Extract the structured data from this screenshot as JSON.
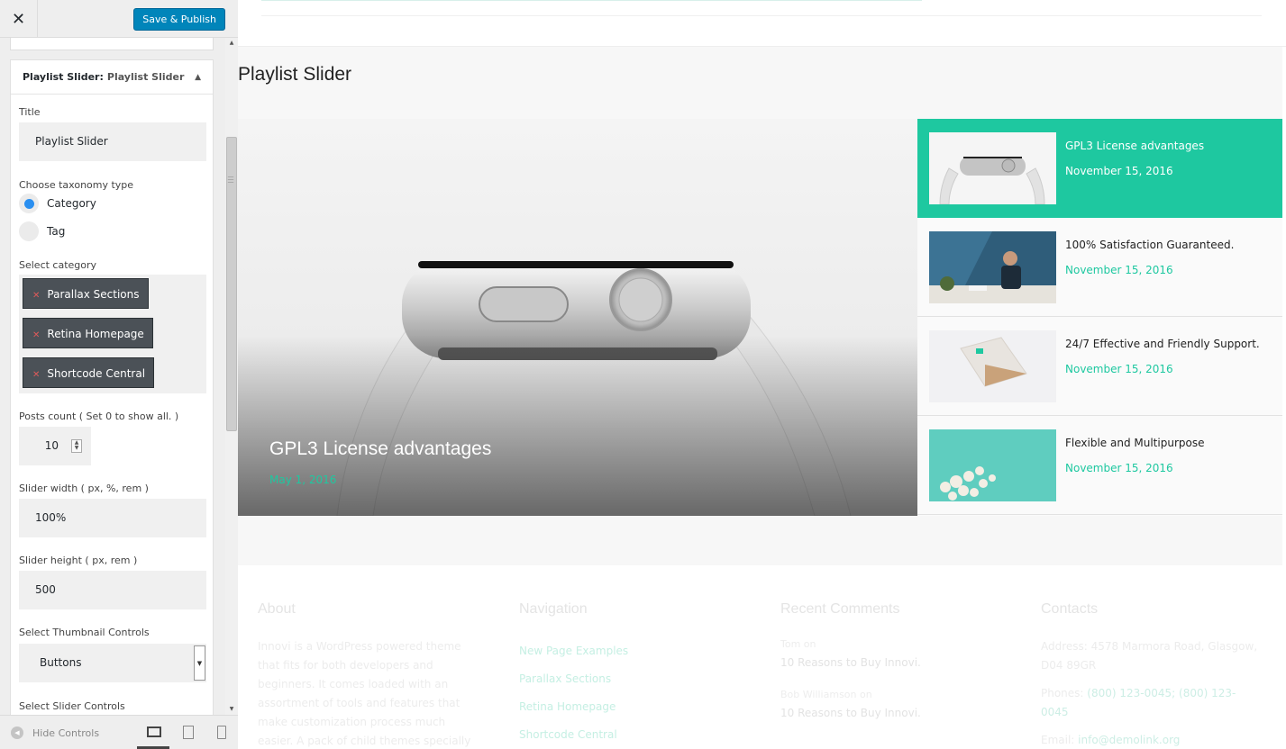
{
  "topbar": {
    "close_label": "✕",
    "publish_label": "Save & Publish"
  },
  "widget": {
    "heading_prefix": "Playlist Slider:",
    "heading_title": "Playlist Slider",
    "title_label": "Title",
    "title_value": "Playlist Slider",
    "taxonomy_label": "Choose taxonomy type",
    "taxonomy_options": [
      {
        "label": "Category",
        "selected": true
      },
      {
        "label": "Tag",
        "selected": false
      }
    ],
    "category_label": "Select category",
    "categories": [
      "Parallax Sections",
      "Retina Homepage",
      "Shortcode Central"
    ],
    "posts_count_label": "Posts count ( Set 0 to show all. )",
    "posts_count_value": "10",
    "width_label": "Slider width ( px, %, rem )",
    "width_value": "100%",
    "height_label": "Slider height ( px, rem )",
    "height_value": "500",
    "thumb_controls_label": "Select Thumbnail Controls",
    "thumb_controls_value": "Buttons",
    "slider_controls_label": "Select Slider Controls"
  },
  "bottombar": {
    "hide_label": "Hide Controls"
  },
  "preview": {
    "section_title": "Playlist Slider",
    "main_slide": {
      "title": "GPL3 License advantages",
      "date": "May 1, 2016"
    },
    "playlist": [
      {
        "title": "GPL3 License advantages",
        "date": "November 15, 2016",
        "active": true,
        "thumb": "watch-thumbnail"
      },
      {
        "title": "100% Satisfaction Guaranteed.",
        "date": "November 15, 2016",
        "active": false,
        "thumb": "desk-worker-thumbnail"
      },
      {
        "title": "24/7 Effective and Friendly Support.",
        "date": "November 15, 2016",
        "active": false,
        "thumb": "package-thumbnail"
      },
      {
        "title": "Flexible and Multipurpose",
        "date": "November 15, 2016",
        "active": false,
        "thumb": "flowers-thumbnail"
      }
    ],
    "footer": {
      "about_title": "About",
      "about_text": "Innovi is a WordPress powered theme that fits for both developers and beginners. It comes loaded with an assortment of tools and features that make customization process much easier. A pack of child themes specially designed",
      "nav_title": "Navigation",
      "nav_links": [
        "New Page Examples",
        "Parallax Sections",
        "Retina Homepage",
        "Shortcode Central"
      ],
      "comments_title": "Recent Comments",
      "comments": [
        {
          "author": "Tom on",
          "post": "10 Reasons to Buy Innovi."
        },
        {
          "author": "Bob Williamson on",
          "post": "10 Reasons to Buy Innovi."
        }
      ],
      "contacts_title": "Contacts",
      "address": "Address: 4578 Marmora Road, Glasgow, D04 89GR",
      "phones_prefix": "Phones:",
      "phones_numbers": "(800) 123-0045; (800) 123-0045",
      "email_prefix": "Email:",
      "email": "info@demolink.org"
    }
  },
  "colors": {
    "accent": "#1ec8a0",
    "publish": "#0085ba",
    "chip": "#4b5157"
  }
}
